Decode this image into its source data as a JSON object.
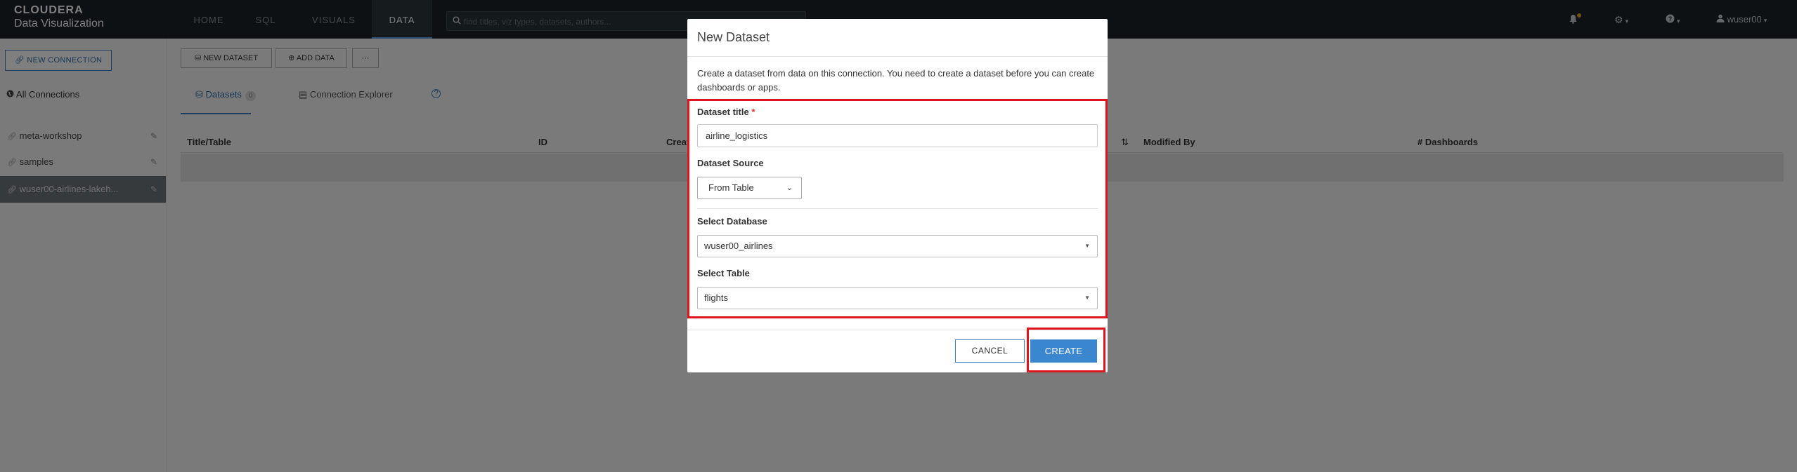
{
  "brand": {
    "line1": "CLOUDERA",
    "line2": "Data Visualization"
  },
  "nav": {
    "tabs": [
      {
        "label": "HOME"
      },
      {
        "label": "SQL"
      },
      {
        "label": "VISUALS"
      },
      {
        "label": "DATA"
      }
    ],
    "active_tab": "DATA",
    "search_placeholder": "find titles, viz types, datasets, authors...",
    "user": "wuser00"
  },
  "sidebar": {
    "new_connection_label": "NEW CONNECTION",
    "all_connections_label": "All Connections",
    "connections": [
      {
        "label": "meta-workshop"
      },
      {
        "label": "samples"
      },
      {
        "label": "wuser00-airlines-lakeh..."
      }
    ]
  },
  "toolbar": {
    "new_dataset_label": "NEW DATASET",
    "add_data_label": "ADD DATA",
    "more_label": "···"
  },
  "subtabs": {
    "datasets_label": "Datasets",
    "datasets_count": "0",
    "explorer_label": "Connection Explorer",
    "help_label": "?"
  },
  "table": {
    "columns": [
      "Title/Table",
      "ID",
      "Created",
      "Modified By",
      "# Dashboards"
    ]
  },
  "modal": {
    "title": "New Dataset",
    "description": "Create a dataset from data on this connection. You need to create a dataset before you can create dashboards or apps.",
    "dataset_title_label": "Dataset title",
    "required_mark": "*",
    "dataset_title_value": "airline_logistics",
    "dataset_source_label": "Dataset Source",
    "dataset_source_value": "From Table",
    "select_database_label": "Select Database",
    "select_database_value": "wuser00_airlines",
    "select_table_label": "Select Table",
    "select_table_value": "flights",
    "cancel_label": "CANCEL",
    "create_label": "CREATE"
  },
  "colors": {
    "topbar": "#1b2329",
    "accent": "#3a87d0",
    "highlight": "#e0141e"
  }
}
